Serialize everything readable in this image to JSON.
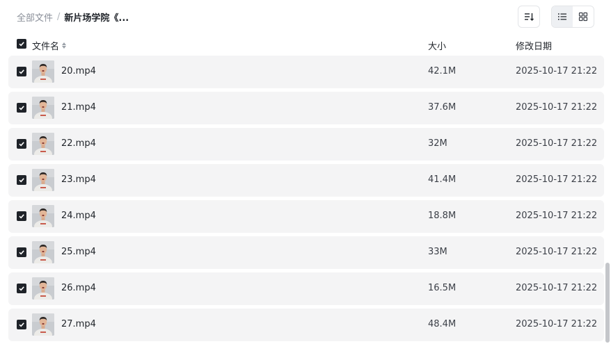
{
  "breadcrumb": {
    "root": "全部文件",
    "separator": "/",
    "current": "新片场学院《..."
  },
  "toolbar": {
    "sort_icon": "sort-descending-icon",
    "view_list_icon": "list-view-icon",
    "view_grid_icon": "grid-view-icon",
    "active_view": "list"
  },
  "columns": {
    "name": "文件名",
    "size": "大小",
    "date": "修改日期"
  },
  "colors": {
    "row_bg": "#f4f4f5",
    "checkbox": "#1f2329",
    "scrollbar": "#c4c6ca"
  },
  "files": [
    {
      "name": "20.mp4",
      "size": "42.1M",
      "date": "2025-10-17 21:22",
      "checked": true
    },
    {
      "name": "21.mp4",
      "size": "37.6M",
      "date": "2025-10-17 21:22",
      "checked": true
    },
    {
      "name": "22.mp4",
      "size": "32M",
      "date": "2025-10-17 21:22",
      "checked": true
    },
    {
      "name": "23.mp4",
      "size": "41.4M",
      "date": "2025-10-17 21:22",
      "checked": true
    },
    {
      "name": "24.mp4",
      "size": "18.8M",
      "date": "2025-10-17 21:22",
      "checked": true
    },
    {
      "name": "25.mp4",
      "size": "33M",
      "date": "2025-10-17 21:22",
      "checked": true
    },
    {
      "name": "26.mp4",
      "size": "16.5M",
      "date": "2025-10-17 21:22",
      "checked": true
    },
    {
      "name": "27.mp4",
      "size": "48.4M",
      "date": "2025-10-17 21:22",
      "checked": true
    }
  ]
}
